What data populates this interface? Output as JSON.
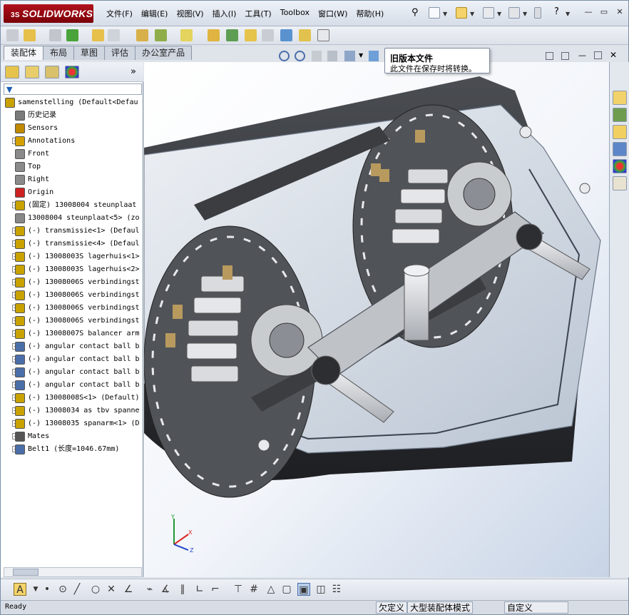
{
  "app": {
    "logo_text": "SOLIDWORKS",
    "logo_prefix": "3S",
    "menu": [
      "文件(F)",
      "编辑(E)",
      "视图(V)",
      "插入(I)",
      "工具(T)",
      "Toolbox",
      "窗口(W)",
      "帮助(H)"
    ],
    "window_controls": [
      "▭",
      "▭",
      "✕"
    ]
  },
  "tabs": [
    "装配体",
    "布局",
    "草图",
    "评估",
    "办公室产品"
  ],
  "active_tab_index": 0,
  "tooltip": {
    "title": "旧版本文件",
    "body": "此文件在保存时将转换。"
  },
  "feature_tree": {
    "expand_more": "»",
    "rows": [
      {
        "label": "samenstelling  (Default<Defau",
        "indent": 0,
        "expander": "none",
        "icon": "assembly-icon",
        "color": "#c9a200"
      },
      {
        "label": "历史记录",
        "indent": 1,
        "expander": "none",
        "icon": "history-icon",
        "color": "#7a7a7a"
      },
      {
        "label": "Sensors",
        "indent": 1,
        "expander": "none",
        "icon": "sensors-icon",
        "color": "#c08a00"
      },
      {
        "label": "Annotations",
        "indent": 1,
        "expander": "plus",
        "icon": "annotations-icon",
        "color": "#d4a000"
      },
      {
        "label": "Front",
        "indent": 1,
        "expander": "none",
        "icon": "plane-icon",
        "color": "#8a8a8a"
      },
      {
        "label": "Top",
        "indent": 1,
        "expander": "none",
        "icon": "plane-icon",
        "color": "#8a8a8a"
      },
      {
        "label": "Right",
        "indent": 1,
        "expander": "none",
        "icon": "plane-icon",
        "color": "#8a8a8a"
      },
      {
        "label": "Origin",
        "indent": 1,
        "expander": "none",
        "icon": "origin-icon",
        "color": "#cc2222"
      },
      {
        "label": "(固定) 13008004 steunplaat",
        "indent": 1,
        "expander": "plus",
        "icon": "part-icon",
        "color": "#c9a200"
      },
      {
        "label": "13008004 steunplaat<5> (zo",
        "indent": 1,
        "expander": "none",
        "icon": "part-icon",
        "color": "#888888"
      },
      {
        "label": "(-) transmissie<1> (Defaul",
        "indent": 1,
        "expander": "plus",
        "icon": "subassembly-icon",
        "color": "#c9a200"
      },
      {
        "label": "(-) transmissie<4> (Defaul",
        "indent": 1,
        "expander": "plus",
        "icon": "subassembly-icon",
        "color": "#c9a200"
      },
      {
        "label": "(-) 13008003S lagerhuis<1>",
        "indent": 1,
        "expander": "plus",
        "icon": "subassembly-icon",
        "color": "#c9a200"
      },
      {
        "label": "(-) 13008003S lagerhuis<2>",
        "indent": 1,
        "expander": "plus",
        "icon": "subassembly-icon",
        "color": "#c9a200"
      },
      {
        "label": "(-) 13008006S verbindingst",
        "indent": 1,
        "expander": "plus",
        "icon": "subassembly-icon",
        "color": "#c9a200"
      },
      {
        "label": "(-) 13008006S verbindingst",
        "indent": 1,
        "expander": "plus",
        "icon": "subassembly-icon",
        "color": "#c9a200"
      },
      {
        "label": "(-) 13008006S verbindingst",
        "indent": 1,
        "expander": "plus",
        "icon": "subassembly-icon",
        "color": "#c9a200"
      },
      {
        "label": "(-) 13008006S verbindingst",
        "indent": 1,
        "expander": "plus",
        "icon": "subassembly-icon",
        "color": "#c9a200"
      },
      {
        "label": "(-) 13008007S balancer arm",
        "indent": 1,
        "expander": "plus",
        "icon": "subassembly-icon",
        "color": "#c9a200"
      },
      {
        "label": "(-) angular contact ball b",
        "indent": 1,
        "expander": "plus",
        "icon": "bearing-icon",
        "color": "#4a6ea8"
      },
      {
        "label": "(-) angular contact ball b",
        "indent": 1,
        "expander": "plus",
        "icon": "bearing-icon",
        "color": "#4a6ea8"
      },
      {
        "label": "(-) angular contact ball b",
        "indent": 1,
        "expander": "plus",
        "icon": "bearing-icon",
        "color": "#4a6ea8"
      },
      {
        "label": "(-) angular contact ball b",
        "indent": 1,
        "expander": "plus",
        "icon": "bearing-icon",
        "color": "#4a6ea8"
      },
      {
        "label": "(-) 13008008S<1> (Default)",
        "indent": 1,
        "expander": "plus",
        "icon": "subassembly-icon",
        "color": "#c9a200"
      },
      {
        "label": "(-) 13008034 as tbv spanne",
        "indent": 1,
        "expander": "plus",
        "icon": "subassembly-icon",
        "color": "#c9a200"
      },
      {
        "label": "(-) 13008035 spanarm<1> (D",
        "indent": 1,
        "expander": "plus",
        "icon": "subassembly-icon",
        "color": "#c9a200"
      },
      {
        "label": "Mates",
        "indent": 1,
        "expander": "plus",
        "icon": "mates-icon",
        "color": "#555555"
      },
      {
        "label": "Belt1 (长度=1046.67mm)",
        "indent": 1,
        "expander": "plus",
        "icon": "belt-icon",
        "color": "#4a6ea8"
      }
    ]
  },
  "status": {
    "ready": "Ready",
    "field1": "欠定义",
    "field2": "大型装配体模式",
    "field3": "自定义"
  },
  "triad": {
    "x": "X",
    "y": "Y",
    "z": "Z"
  },
  "colors": {
    "accent": "#1a5fb4",
    "brand_red": "#b0101a",
    "model_dark": "#3a3d42",
    "model_light": "#d8dadd",
    "brass": "#b89a5e"
  }
}
